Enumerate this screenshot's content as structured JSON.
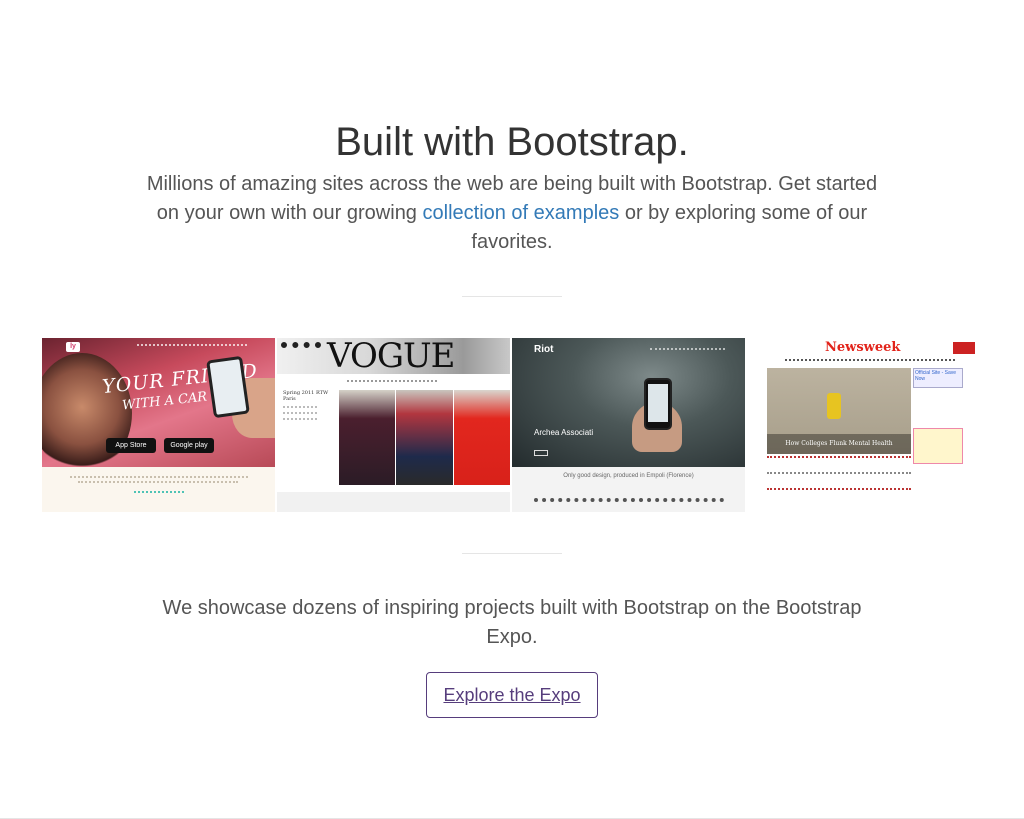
{
  "heading": "Built with Bootstrap.",
  "lead": {
    "before": "Millions of amazing sites across the web are being built with Bootstrap. Get started on your own with our growing ",
    "link": "collection of examples",
    "after": " or by exploring some of our favorites."
  },
  "gallery": [
    {
      "site": "Lyft",
      "script_line1": "YOUR FRIEND",
      "script_line2": "WITH A CAR",
      "badge_apple": "App Store",
      "badge_google": "Google play"
    },
    {
      "site": "Vogue",
      "wordmark": "VOGUE",
      "side_heading": "Spring 2011 RTW Paris"
    },
    {
      "site": "Riot",
      "logo": "Riot",
      "headline": "Archea Associati",
      "tagline": "Only good design, produced in Empoli (Florence)"
    },
    {
      "site": "Newsweek",
      "brand": "Newsweek",
      "caption": "How Colleges Flunk Mental Health",
      "sidebar_ad": "Official Site - Save Now"
    }
  ],
  "showcase_text": "We showcase dozens of inspiring projects built with Bootstrap on the Bootstrap Expo.",
  "expo_button": "Explore the Expo",
  "colors": {
    "link": "#337ab7",
    "brand_purple": "#563d7c",
    "text": "#333333",
    "muted": "#555555"
  }
}
